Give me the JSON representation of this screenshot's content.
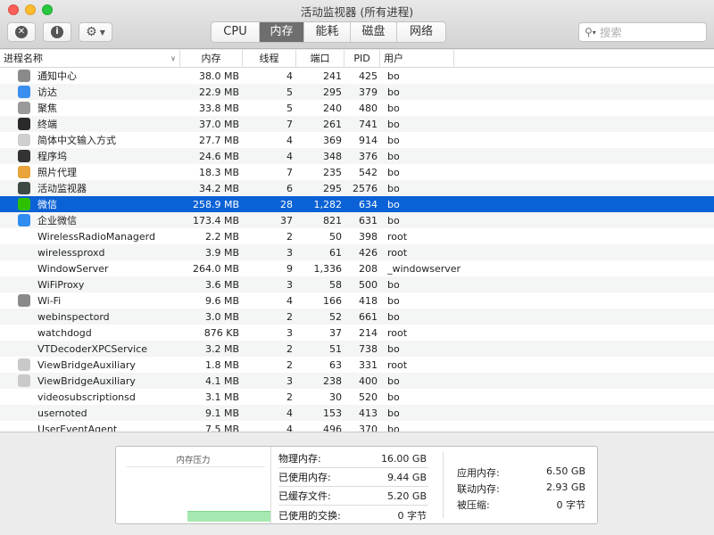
{
  "window": {
    "title": "活动监视器 (所有进程)"
  },
  "toolbar": {
    "info_label": "i"
  },
  "tabs": [
    {
      "label": "CPU",
      "active": false
    },
    {
      "label": "内存",
      "active": true
    },
    {
      "label": "能耗",
      "active": false
    },
    {
      "label": "磁盘",
      "active": false
    },
    {
      "label": "网络",
      "active": false
    }
  ],
  "search": {
    "placeholder": "搜索",
    "value": ""
  },
  "columns": {
    "name": "进程名称",
    "memory": "内存",
    "threads": "线程",
    "ports": "端口",
    "pid": "PID",
    "user": "用户"
  },
  "processes": [
    {
      "name": "通知中心",
      "memory": "38.0 MB",
      "threads": "4",
      "ports": "241",
      "pid": "425",
      "user": "bo",
      "icon": "notification-center-icon",
      "icon_color": "#8a8a8a"
    },
    {
      "name": "访达",
      "memory": "22.9 MB",
      "threads": "5",
      "ports": "295",
      "pid": "379",
      "user": "bo",
      "icon": "finder-icon",
      "icon_color": "#3a8ef0"
    },
    {
      "name": "聚焦",
      "memory": "33.8 MB",
      "threads": "5",
      "ports": "240",
      "pid": "480",
      "user": "bo",
      "icon": "spotlight-icon",
      "icon_color": "#9a9a9a"
    },
    {
      "name": "终端",
      "memory": "37.0 MB",
      "threads": "7",
      "ports": "261",
      "pid": "741",
      "user": "bo",
      "icon": "terminal-icon",
      "icon_color": "#2a2a2a"
    },
    {
      "name": "简体中文输入方式",
      "memory": "27.7 MB",
      "threads": "4",
      "ports": "369",
      "pid": "914",
      "user": "bo",
      "icon": "input-method-icon",
      "icon_color": "#cfcfcf"
    },
    {
      "name": "程序坞",
      "memory": "24.6 MB",
      "threads": "4",
      "ports": "348",
      "pid": "376",
      "user": "bo",
      "icon": "dock-icon",
      "icon_color": "#333333"
    },
    {
      "name": "照片代理",
      "memory": "18.3 MB",
      "threads": "7",
      "ports": "235",
      "pid": "542",
      "user": "bo",
      "icon": "photos-icon",
      "icon_color": "#e8a33a"
    },
    {
      "name": "活动监视器",
      "memory": "34.2 MB",
      "threads": "6",
      "ports": "295",
      "pid": "2576",
      "user": "bo",
      "icon": "activity-monitor-icon",
      "icon_color": "#3f4a45"
    },
    {
      "name": "微信",
      "memory": "258.9 MB",
      "threads": "28",
      "ports": "1,282",
      "pid": "634",
      "user": "bo",
      "icon": "wechat-icon",
      "icon_color": "#2dc100",
      "selected": true
    },
    {
      "name": "企业微信",
      "memory": "173.4 MB",
      "threads": "37",
      "ports": "821",
      "pid": "631",
      "user": "bo",
      "icon": "wecom-icon",
      "icon_color": "#2f8cf0"
    },
    {
      "name": "WirelessRadioManagerd",
      "memory": "2.2 MB",
      "threads": "2",
      "ports": "50",
      "pid": "398",
      "user": "root",
      "icon": ""
    },
    {
      "name": "wirelessproxd",
      "memory": "3.9 MB",
      "threads": "3",
      "ports": "61",
      "pid": "426",
      "user": "root",
      "icon": ""
    },
    {
      "name": "WindowServer",
      "memory": "264.0 MB",
      "threads": "9",
      "ports": "1,336",
      "pid": "208",
      "user": "_windowserver",
      "icon": ""
    },
    {
      "name": "WiFiProxy",
      "memory": "3.6 MB",
      "threads": "3",
      "ports": "58",
      "pid": "500",
      "user": "bo",
      "icon": ""
    },
    {
      "name": "Wi-Fi",
      "memory": "9.6 MB",
      "threads": "4",
      "ports": "166",
      "pid": "418",
      "user": "bo",
      "icon": "wifi-app-icon",
      "icon_color": "#8a8a8a"
    },
    {
      "name": "webinspectord",
      "memory": "3.0 MB",
      "threads": "2",
      "ports": "52",
      "pid": "661",
      "user": "bo",
      "icon": ""
    },
    {
      "name": "watchdogd",
      "memory": "876 KB",
      "threads": "3",
      "ports": "37",
      "pid": "214",
      "user": "root",
      "icon": ""
    },
    {
      "name": "VTDecoderXPCService",
      "memory": "3.2 MB",
      "threads": "2",
      "ports": "51",
      "pid": "738",
      "user": "bo",
      "icon": ""
    },
    {
      "name": "ViewBridgeAuxiliary",
      "memory": "1.8 MB",
      "threads": "2",
      "ports": "63",
      "pid": "331",
      "user": "root",
      "icon": "viewbridge-icon",
      "icon_color": "#c9c9c9"
    },
    {
      "name": "ViewBridgeAuxiliary",
      "memory": "4.1 MB",
      "threads": "3",
      "ports": "238",
      "pid": "400",
      "user": "bo",
      "icon": "viewbridge-icon",
      "icon_color": "#c9c9c9"
    },
    {
      "name": "videosubscriptionsd",
      "memory": "3.1 MB",
      "threads": "2",
      "ports": "30",
      "pid": "520",
      "user": "bo",
      "icon": ""
    },
    {
      "name": "usernoted",
      "memory": "9.1 MB",
      "threads": "4",
      "ports": "153",
      "pid": "413",
      "user": "bo",
      "icon": ""
    },
    {
      "name": "UserEventAgent",
      "memory": "7.5 MB",
      "threads": "4",
      "ports": "496",
      "pid": "370",
      "user": "bo",
      "icon": ""
    }
  ],
  "memory_summary": {
    "pressure_label": "内存压力",
    "physical_label": "物理内存:",
    "physical_value": "16.00 GB",
    "used_label": "已使用内存:",
    "used_value": "9.44 GB",
    "cached_label": "已缓存文件:",
    "cached_value": "5.20 GB",
    "swap_label": "已使用的交换:",
    "swap_value": "0 字节",
    "app_label": "应用内存:",
    "app_value": "6.50 GB",
    "wired_label": "联动内存:",
    "wired_value": "2.93 GB",
    "compressed_label": "被压缩:",
    "compressed_value": "0 字节"
  }
}
